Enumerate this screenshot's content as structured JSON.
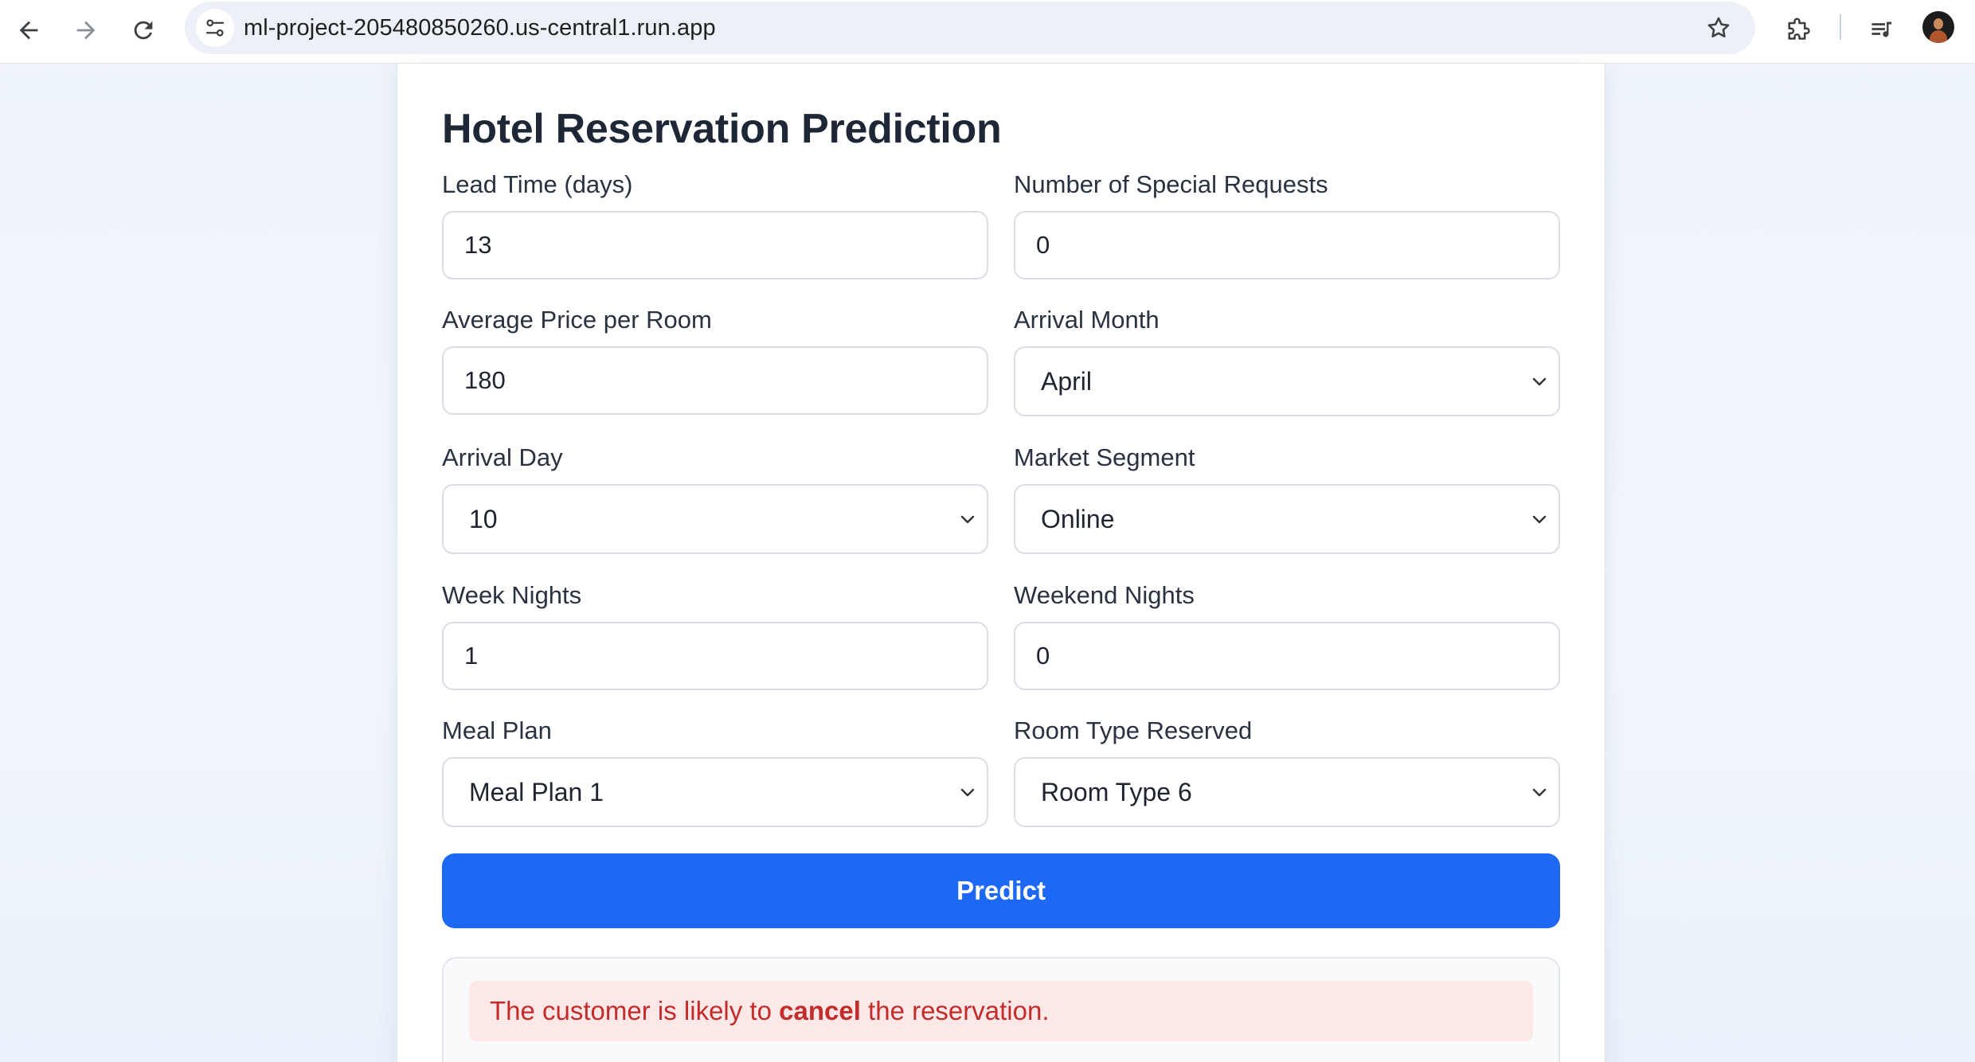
{
  "browser": {
    "url": "ml-project-205480850260.us-central1.run.app",
    "icons": {
      "back": "arrow-left-icon",
      "forward": "arrow-right-icon",
      "reload": "reload-icon",
      "site_info": "tune-icon",
      "bookmark": "star-icon",
      "extensions": "puzzle-icon",
      "media": "playlist-music-icon",
      "profile": "avatar"
    }
  },
  "page": {
    "title": "Hotel Reservation Prediction",
    "fields": {
      "lead_time": {
        "label": "Lead Time (days)",
        "value": "13"
      },
      "special_requests": {
        "label": "Number of Special Requests",
        "value": "0"
      },
      "avg_price": {
        "label": "Average Price per Room",
        "value": "180"
      },
      "arrival_month": {
        "label": "Arrival Month",
        "value": "April"
      },
      "arrival_day": {
        "label": "Arrival Day",
        "value": "10"
      },
      "market_segment": {
        "label": "Market Segment",
        "value": "Online"
      },
      "week_nights": {
        "label": "Week Nights",
        "value": "1"
      },
      "weekend_nights": {
        "label": "Weekend Nights",
        "value": "0"
      },
      "meal_plan": {
        "label": "Meal Plan",
        "value": "Meal Plan 1"
      },
      "room_type": {
        "label": "Room Type Reserved",
        "value": "Room Type 6"
      }
    },
    "predict_label": "Predict",
    "result": {
      "prefix": "The customer is likely to ",
      "emphasis": "cancel",
      "suffix": " the reservation."
    }
  },
  "colors": {
    "primary_button": "#1d68f5",
    "result_text": "#c42b2b",
    "result_background": "#fde8e8"
  }
}
